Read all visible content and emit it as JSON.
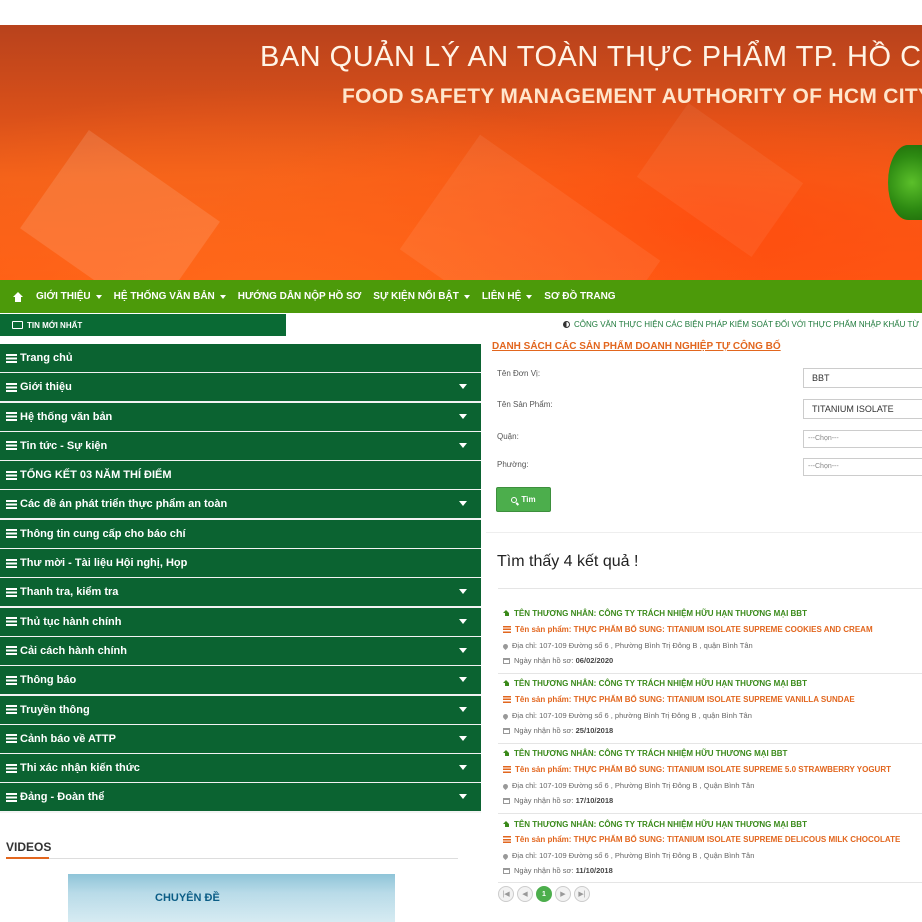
{
  "banner": {
    "title": "BAN QUẢN LÝ AN TOÀN THỰC PHẨM TP. HỒ CHÍ MINH",
    "subtitle": "FOOD SAFETY MANAGEMENT AUTHORITY OF HCM CITY"
  },
  "nav": {
    "items": [
      {
        "label": "GIỚI THIỆU",
        "dropdown": true
      },
      {
        "label": "HỆ THỐNG VĂN BẢN",
        "dropdown": true
      },
      {
        "label": "HƯỚNG DẪN NỘP HỒ SƠ",
        "dropdown": false
      },
      {
        "label": "SỰ KIỆN NỔI BẬT",
        "dropdown": true
      },
      {
        "label": "LIÊN HỆ",
        "dropdown": true
      },
      {
        "label": "SƠ ĐỒ TRANG",
        "dropdown": false
      }
    ]
  },
  "ticker": {
    "label": "TIN MỚI NHẤT",
    "text": "CÔNG VĂN THỰC HIỆN CÁC BIỆN PHÁP KIỂM SOÁT ĐỐI VỚI THỰC PHẨM NHẬP KHẨU TỪ"
  },
  "sidebar": {
    "items": [
      {
        "label": "Trang chủ",
        "dropdown": false
      },
      {
        "label": "Giới thiệu",
        "dropdown": true
      },
      {
        "label": "Hệ thống văn bản",
        "dropdown": true
      },
      {
        "label": "Tin tức - Sự kiện",
        "dropdown": true
      },
      {
        "label": "TỔNG KẾT 03 NĂM THÍ ĐIỂM",
        "dropdown": false
      },
      {
        "label": "Các đề án phát triển thực phẩm an toàn",
        "dropdown": true
      },
      {
        "label": "Thông tin cung cấp cho báo chí",
        "dropdown": false
      },
      {
        "label": "Thư mời - Tài liệu Hội nghị, Họp",
        "dropdown": false
      },
      {
        "label": "Thanh tra, kiểm tra",
        "dropdown": true
      },
      {
        "label": "Thủ tục hành chính",
        "dropdown": true
      },
      {
        "label": "Cải cách hành chính",
        "dropdown": true
      },
      {
        "label": "Thông báo",
        "dropdown": true
      },
      {
        "label": "Truyền thông",
        "dropdown": true
      },
      {
        "label": "Cảnh báo về ATTP",
        "dropdown": true
      },
      {
        "label": "Thi xác nhận kiến thức",
        "dropdown": true
      },
      {
        "label": "Đảng - Đoàn thể",
        "dropdown": true
      }
    ]
  },
  "videos": {
    "title": "VIDEOS",
    "thumb_text": "CHUYÊN ĐỀ"
  },
  "search": {
    "title": "DANH SÁCH CÁC SẢN PHẨM DOANH NGHIỆP TỰ CÔNG BỐ",
    "unit_label": "Tên Đơn Vị:",
    "unit_value": "BBT",
    "product_label": "Tên Sản Phẩm:",
    "product_value": "TITANIUM ISOLATE",
    "district_label": "Quận:",
    "district_value": "---Chọn---",
    "ward_label": "Phường:",
    "ward_value": "---Chọn---",
    "button_label": "Tìm"
  },
  "results": {
    "count_text": "Tìm thấy 4 kết quả !",
    "items": [
      {
        "company": "TÊN THƯƠNG NHÂN: CÔNG TY TRÁCH NHIỆM HỮU HẠN THƯƠNG MẠI BBT",
        "product": "Tên sản phẩm: THỰC PHẨM BỔ SUNG: TITANIUM ISOLATE SUPREME COOKIES AND CREAM",
        "address": "Địa chỉ: 107-109 Đường số 6 , Phường Bình Trị Đông B , quận Bình Tân",
        "date_label": "Ngày nhận hồ sơ:",
        "date": "06/02/2020"
      },
      {
        "company": "TÊN THƯƠNG NHÂN: CÔNG TY TRÁCH NHIỆM HỮU HẠN THƯƠNG MẠI BBT",
        "product": "Tên sản phẩm: THỰC PHẨM BỔ SUNG: TITANIUM ISOLATE SUPREME VANILLA SUNDAE",
        "address": "Địa chỉ: 107-109 Đường số 6 , phường Bình Trị Đông B , quận Bình Tân",
        "date_label": "Ngày nhận hồ sơ:",
        "date": "25/10/2018"
      },
      {
        "company": "TÊN THƯƠNG NHÂN: CÔNG TY TRÁCH NHIỆM HỮU THƯƠNG MẠI BBT",
        "product": "Tên sản phẩm: THỰC PHẨM BỔ SUNG: TITANIUM ISOLATE SUPREME 5.0 STRAWBERRY YOGURT",
        "address": "Địa chỉ: 107-109 Đường số 6 , Phường Bình Trị Đông B , Quận Bình Tân",
        "date_label": "Ngày nhận hồ sơ:",
        "date": "17/10/2018"
      },
      {
        "company": "TÊN THƯƠNG NHÂN: CÔNG TY TRÁCH NHIỆM HỮU HẠN THƯƠNG MẠI BBT",
        "product": "Tên sản phẩm: THỰC PHẨM BỔ SUNG: TITANIUM ISOLATE SUPREME DELICOUS MILK CHOCOLATE",
        "address": "Địa chỉ: 107-109 Đường số 6 , Phường Bình Trị Đông B , Quận Bình Tân",
        "date_label": "Ngày nhận hồ sơ:",
        "date": "11/10/2018"
      }
    ]
  },
  "pager": {
    "first": "|◀",
    "prev": "◀",
    "current": "1",
    "next": "▶",
    "last": "▶|"
  },
  "colors": {
    "nav_green": "#4c9a0a",
    "sidebar_green": "#0b6331",
    "accent_orange": "#e2661e",
    "button_green": "#4cae4c"
  }
}
